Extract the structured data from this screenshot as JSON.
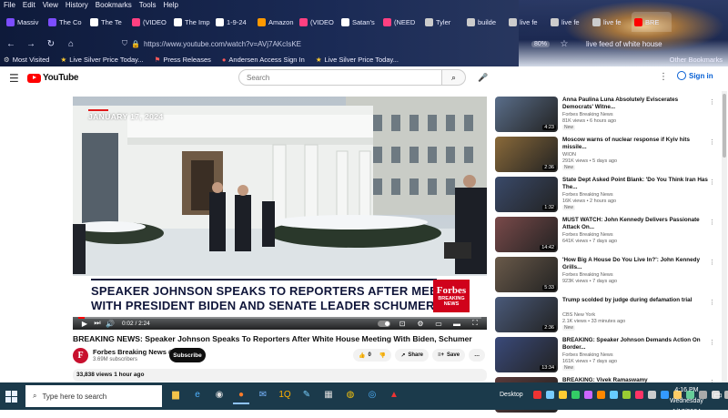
{
  "browser": {
    "menu": [
      "File",
      "Edit",
      "View",
      "History",
      "Bookmarks",
      "Tools",
      "Help"
    ],
    "tabs": [
      {
        "label": "Massiv",
        "color": "#7c4dff"
      },
      {
        "label": "The Co",
        "color": "#7c4dff"
      },
      {
        "label": "The Te",
        "color": "#ffffff"
      },
      {
        "label": "(VIDEO",
        "color": "#ff4081"
      },
      {
        "label": "The Imp",
        "color": "#ffffff"
      },
      {
        "label": "1-9-24",
        "color": "#ffffff"
      },
      {
        "label": "Amazon",
        "color": "#ff9900"
      },
      {
        "label": "(VIDEO",
        "color": "#ff4081"
      },
      {
        "label": "Satan's",
        "color": "#ffffff"
      },
      {
        "label": "(NEED",
        "color": "#ff4081"
      },
      {
        "label": "Tyler",
        "color": "#cccccc"
      },
      {
        "label": "builde",
        "color": "#cccccc"
      },
      {
        "label": "live fe",
        "color": "#cccccc"
      },
      {
        "label": "live fe",
        "color": "#cccccc"
      },
      {
        "label": "live fe",
        "color": "#cccccc"
      },
      {
        "label": "BRE",
        "color": "#ff0000"
      }
    ],
    "url": "https://www.youtube.com/watch?v=AVj7AKcIsKE",
    "zoom": "80%",
    "omnibox_search": "live feed of white house",
    "bookmarks": [
      {
        "label": "Most Visited",
        "icon": "gear-icon"
      },
      {
        "label": "Live Silver Price Today...",
        "icon": "star-icon"
      },
      {
        "label": "Press Releases",
        "icon": "flag-icon"
      },
      {
        "label": "Andersen Access Sign In",
        "icon": "circle-icon"
      },
      {
        "label": "Live Silver Price Today...",
        "icon": "star-icon"
      }
    ],
    "other_bookmarks": "Other Bookmarks"
  },
  "youtube": {
    "logo_text": "YouTube",
    "search_placeholder": "Search",
    "signin": "Sign in"
  },
  "player": {
    "date_tag": "JANUARY 17, 2024",
    "headline_line1": "SPEAKER JOHNSON SPEAKS TO REPORTERS AFTER MEETING",
    "headline_line2": "WITH PRESIDENT BIDEN AND SENATE LEADER SCHUMER",
    "badge_brand": "Forbes",
    "badge_line1": "BREAKING",
    "badge_line2": "NEWS",
    "time": "0:02 / 2:24",
    "progress": 0.015
  },
  "video": {
    "title": "BREAKING NEWS: Speaker Johnson Speaks To Reporters After White House Meeting With Biden, Schumer",
    "channel": "Forbes Breaking News",
    "subscribers": "3.69M subscribers",
    "subscribe_label": "Subscribe",
    "likes": "0",
    "share_label": "Share",
    "save_label": "Save",
    "views_time": "33,838 views  1 hour ago"
  },
  "recommendations": [
    {
      "title": "Anna Paulina Luna Absolutely Eviscerates Democrats' Witne...",
      "channel": "Forbes Breaking News",
      "meta": "81K views • 6 hours ago",
      "badge": "New",
      "duration": "4:23",
      "thumb_color": "#5a6e8a"
    },
    {
      "title": "Moscow warns of nuclear response if Kyiv hits missile...",
      "channel": "WION",
      "meta": "291K views • 5 days ago",
      "badge": "New",
      "duration": "2:36",
      "thumb_color": "#8a6a3a"
    },
    {
      "title": "State Dept Asked Point Blank: 'Do You Think Iran Has The...",
      "channel": "Forbes Breaking News",
      "meta": "16K views • 2 hours ago",
      "badge": "New",
      "duration": "1:32",
      "thumb_color": "#3a4a6a"
    },
    {
      "title": "MUST WATCH: John Kennedy Delivers Passionate Attack On...",
      "channel": "Forbes Breaking News",
      "meta": "641K views • 7 days ago",
      "badge": "",
      "duration": "14:42",
      "thumb_color": "#7a4a4a"
    },
    {
      "title": "'How Big A House Do You Live In?': John Kennedy Grills...",
      "channel": "Forbes Breaking News",
      "meta": "923K views • 7 days ago",
      "badge": "",
      "duration": "5:33",
      "thumb_color": "#6a5a4a"
    },
    {
      "title": "Trump scolded by judge during defamation trial",
      "channel": "CBS New York",
      "meta": "2.1K views • 33 minutes ago",
      "badge": "New",
      "duration": "2:36",
      "thumb_color": "#4a5a7a"
    },
    {
      "title": "BREAKING: Speaker Johnson Demands Action On Border...",
      "channel": "Forbes Breaking News",
      "meta": "161K views • 7 days ago",
      "badge": "New",
      "duration": "13:34",
      "thumb_color": "#3a4a7a"
    },
    {
      "title": "BREAKING: Vivek Ramaswamy",
      "channel": "",
      "meta": "",
      "badge": "",
      "duration": "",
      "thumb_color": "#5a3a3a"
    }
  ],
  "taskbar": {
    "search_placeholder": "Type here to search",
    "desktop_label": "Desktop",
    "time": "4:16 PM",
    "day": "Wednesday",
    "date": "1/17/2024"
  }
}
